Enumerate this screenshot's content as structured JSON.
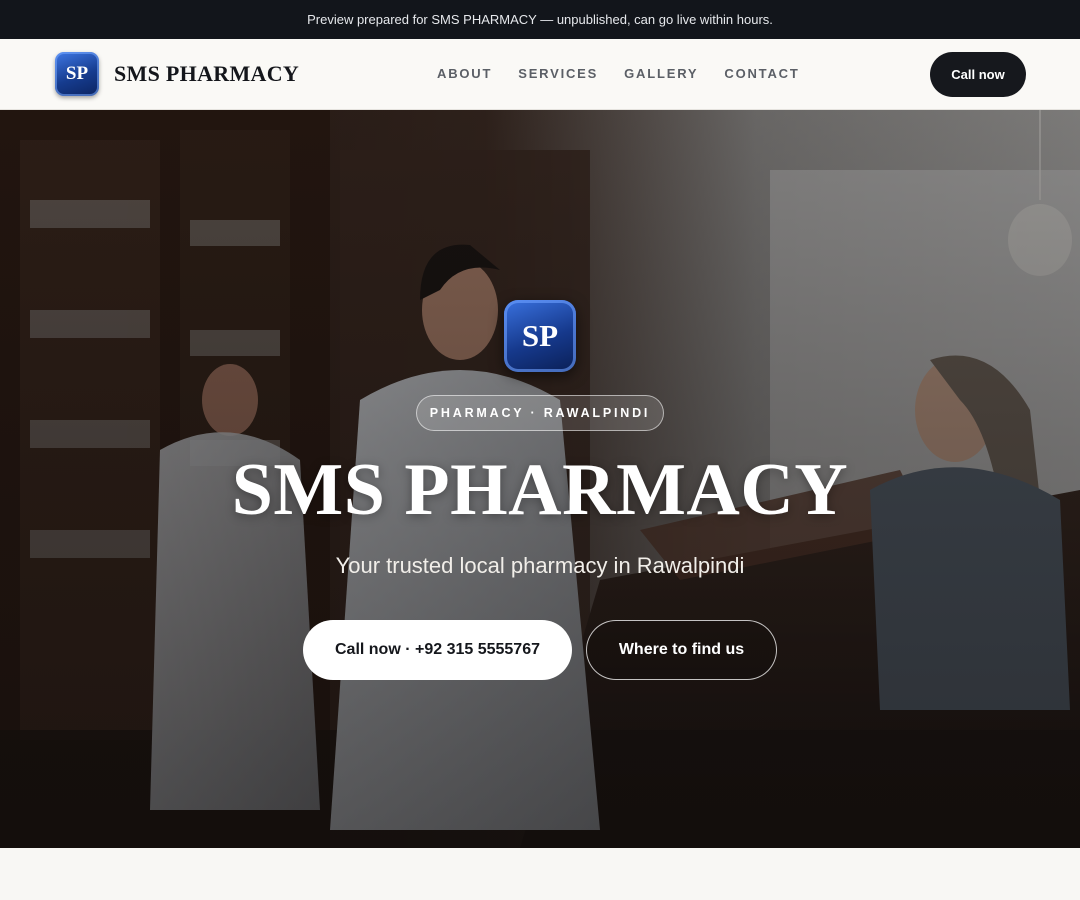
{
  "preview_bar": {
    "text": "Preview prepared for SMS PHARMACY — unpublished, can go live within hours."
  },
  "header": {
    "logo_initials": "SP",
    "brand_name": "SMS PHARMACY",
    "nav": [
      {
        "label": "ABOUT"
      },
      {
        "label": "SERVICES"
      },
      {
        "label": "GALLERY"
      },
      {
        "label": "CONTACT"
      }
    ],
    "cta_label": "Call now"
  },
  "hero": {
    "logo_initials": "SP",
    "badge": "PHARMACY · RAWALPINDI",
    "title": "SMS PHARMACY",
    "subtitle": "Your trusted local pharmacy in Rawalpindi",
    "primary_button": "Call now · +92 315 5555767",
    "secondary_button": "Where to find us",
    "background_image": "pharmacists-in-wooden-shelved-pharmacy-photo"
  },
  "colors": {
    "dark": "#12151b",
    "logo_blue": "#163c8f",
    "page_bg": "#f8f7f4"
  }
}
